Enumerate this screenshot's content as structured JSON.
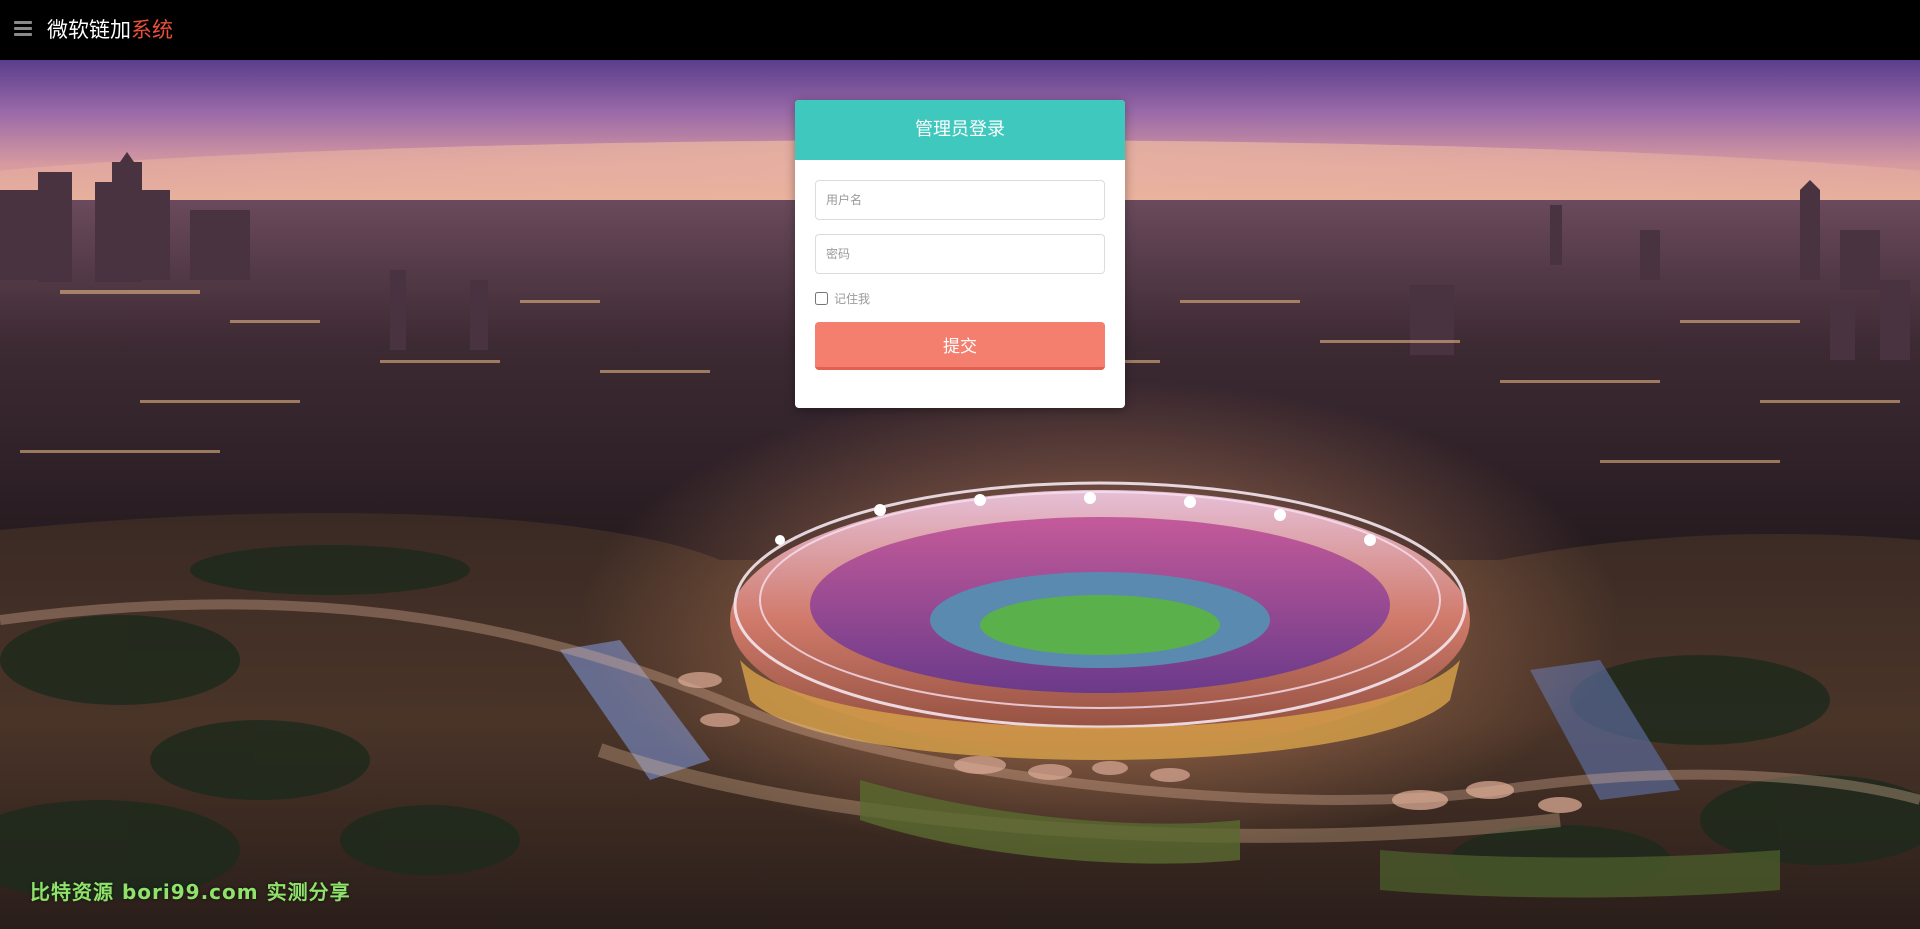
{
  "topbar": {
    "icon": "hamburger-menu-icon",
    "brand_main": "微软链加",
    "brand_accent": "系统",
    "brand_accent_color": "#e8503a"
  },
  "login": {
    "title": "管理员登录",
    "header_color": "#3fc8bd",
    "username_placeholder": "用户名",
    "password_placeholder": "密码",
    "remember_label": "记住我",
    "remember_checked": false,
    "submit_label": "提交",
    "submit_color": "#f47f6f"
  },
  "background": {
    "icon": "stadium-city-night-image"
  },
  "watermark": {
    "text": "比特资源 bori99.com 实测分享"
  }
}
